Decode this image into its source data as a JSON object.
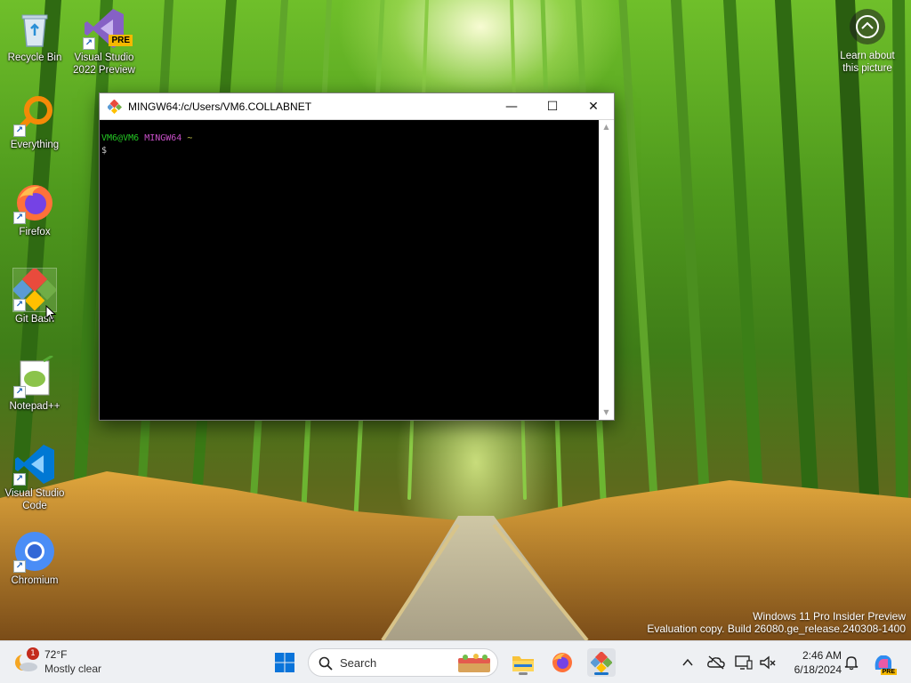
{
  "desktop": {
    "icons": [
      {
        "label": "Recycle Bin"
      },
      {
        "label": "Visual Studio 2022 Preview",
        "badge": "PRE"
      },
      {
        "label": "Everything"
      },
      {
        "label": "Firefox"
      },
      {
        "label": "Git Bash"
      },
      {
        "label": "Notepad++"
      },
      {
        "label": "Visual Studio Code"
      },
      {
        "label": "Chromium"
      }
    ],
    "learn_picture": "Learn about this picture"
  },
  "terminal": {
    "title": "MINGW64:/c/Users/VM6.COLLABNET",
    "prompt_user": "VM6@VM6",
    "prompt_host": "MINGW64",
    "prompt_path": "~",
    "prompt_symbol": "$",
    "controls": {
      "minimize": "—",
      "maximize": "☐",
      "close": "✕"
    }
  },
  "watermark": {
    "line1": "Windows 11 Pro Insider Preview",
    "line2": "Evaluation copy. Build 26080.ge_release.240308-1400"
  },
  "taskbar": {
    "weather": {
      "temp": "72°F",
      "condition": "Mostly clear",
      "badge": "1"
    },
    "search_label": "Search",
    "clock": {
      "time": "2:46 AM",
      "date": "6/18/2024"
    },
    "copilot_badge": "PRE"
  },
  "colors": {
    "taskbar_bg": "#eef0f3",
    "prompt_user": "#24c824",
    "prompt_host": "#c850c8",
    "prompt_path": "#c8c84b"
  }
}
